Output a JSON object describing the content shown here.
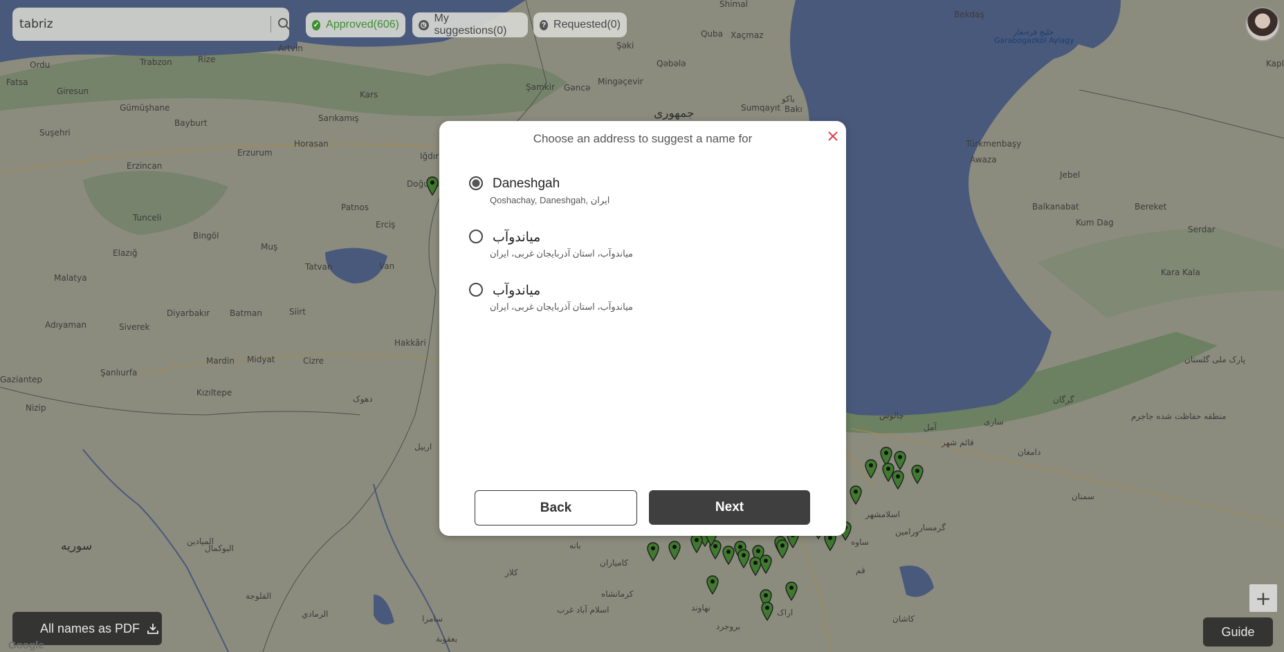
{
  "search": {
    "value": "tabriz",
    "icon": "search-icon"
  },
  "filters": [
    {
      "label": "Approved(606)",
      "icon": "check-circle-icon",
      "color": "#3d8e2f"
    },
    {
      "label": "My suggestions(0)",
      "icon": "clock-icon"
    },
    {
      "label": "Requested(0)",
      "icon": "question-circle-icon"
    }
  ],
  "modal": {
    "title": "Choose an address to suggest a name for",
    "options": [
      {
        "name": "Daneshgah",
        "address": "Qoshachay, Daneshgah, ایران",
        "selected": true
      },
      {
        "name": "میاندوآب",
        "address": "میاندوآب، استان آذربایجان غربی، ایران",
        "selected": false
      },
      {
        "name": "میاندوآب",
        "address": "میاندوآب، استان آذربایجان غربی، ایران",
        "selected": false
      }
    ],
    "back_label": "Back",
    "next_label": "Next"
  },
  "bottom": {
    "pdf_label": "All names as PDF",
    "guide_label": "Guide",
    "zoom_in": "+"
  },
  "map": {
    "labels": [
      {
        "text": "Bekdaş"
      },
      {
        "text": "خلیج قره‌بغاز"
      },
      {
        "text": "Garabogazköl Aylagy"
      },
      {
        "text": "Shimal"
      },
      {
        "text": "Quba"
      },
      {
        "text": "Xaçmaz"
      },
      {
        "text": "Şəki"
      },
      {
        "text": "Qəbələ"
      },
      {
        "text": "Gəncə"
      },
      {
        "text": "Mingəçevir"
      },
      {
        "text": "Şamkir"
      },
      {
        "text": "Sumqayıt"
      },
      {
        "text": "Bakı"
      },
      {
        "text": "باکو"
      },
      {
        "text": "جمهوری"
      },
      {
        "text": "Ordu"
      },
      {
        "text": "Trabzon"
      },
      {
        "text": "Rize"
      },
      {
        "text": "Artvin"
      },
      {
        "text": "Fatsa"
      },
      {
        "text": "Giresun"
      },
      {
        "text": "Gümüşhane"
      },
      {
        "text": "Bayburt"
      },
      {
        "text": "Kars"
      },
      {
        "text": "Sarıkamış"
      },
      {
        "text": "Horasan"
      },
      {
        "text": "Erzurum"
      },
      {
        "text": "Erzincan"
      },
      {
        "text": "Suşehri"
      },
      {
        "text": "Iğdır"
      },
      {
        "text": "Doğubayazıt"
      },
      {
        "text": "Patnos"
      },
      {
        "text": "Erciş"
      },
      {
        "text": "Tunceli"
      },
      {
        "text": "Bingöl"
      },
      {
        "text": "Muş"
      },
      {
        "text": "Van"
      },
      {
        "text": "Tatvan"
      },
      {
        "text": "Elazığ"
      },
      {
        "text": "Malatya"
      },
      {
        "text": "Diyarbakır"
      },
      {
        "text": "Batman"
      },
      {
        "text": "Siirt"
      },
      {
        "text": "Siverek"
      },
      {
        "text": "Adıyaman"
      },
      {
        "text": "Mardin"
      },
      {
        "text": "Midyat"
      },
      {
        "text": "Cizre"
      },
      {
        "text": "Hakkâri"
      },
      {
        "text": "Şanlıurfa"
      },
      {
        "text": "Kızıltepe"
      },
      {
        "text": "Nizip"
      },
      {
        "text": "Gaziantep"
      },
      {
        "text": "دهوک"
      },
      {
        "text": "اربيل"
      },
      {
        "text": "سوريه"
      },
      {
        "text": "Türkmenbaşy"
      },
      {
        "text": "Awaza"
      },
      {
        "text": "Jebel"
      },
      {
        "text": "Balkanabat"
      },
      {
        "text": "Kum Dag"
      },
      {
        "text": "Bereket"
      },
      {
        "text": "Serdar"
      },
      {
        "text": "Kara Kala"
      },
      {
        "text": "گرگان"
      },
      {
        "text": "ساری"
      },
      {
        "text": "آمل"
      },
      {
        "text": "چالوس"
      },
      {
        "text": "قائم شهر"
      },
      {
        "text": "سمنان"
      },
      {
        "text": "دامغان"
      },
      {
        "text": "اسلامشهر"
      },
      {
        "text": "ورامین"
      },
      {
        "text": "گرمسار"
      },
      {
        "text": "قم"
      },
      {
        "text": "کاشان"
      },
      {
        "text": "کرمانشاه"
      },
      {
        "text": "اسلام آباد غرب"
      },
      {
        "text": "بروجرد"
      },
      {
        "text": "اراک"
      },
      {
        "text": "نهاوند"
      },
      {
        "text": "سامرا"
      },
      {
        "text": "بعقوبة"
      },
      {
        "text": "الفلوجة"
      },
      {
        "text": "الرمادي"
      },
      {
        "text": "البوكمال"
      },
      {
        "text": "الميادين"
      },
      {
        "text": "پارک ملی گلستان"
      },
      {
        "text": "منطقه حفاظت شده جاجرم"
      },
      {
        "text": "ساوه"
      },
      {
        "text": "کامیاران"
      },
      {
        "text": "کلار"
      },
      {
        "text": "بانه"
      },
      {
        "text": "Kaplan"
      }
    ]
  }
}
